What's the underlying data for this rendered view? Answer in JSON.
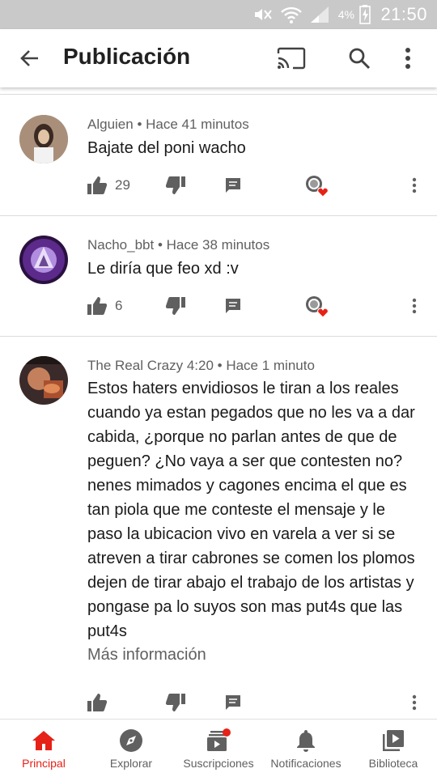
{
  "status_bar": {
    "battery": "4%",
    "time": "21:50"
  },
  "app_bar": {
    "title": "Publicación",
    "icons": [
      "back-arrow-icon",
      "cast-icon",
      "search-icon",
      "more-vert-icon"
    ]
  },
  "comments": [
    {
      "author": "Alguien",
      "time": "Hace 41 minutos",
      "text": "Bajate del poni wacho",
      "likes": "29"
    },
    {
      "author": "Nacho_bbt",
      "time": "Hace 38 minutos",
      "text": "Le diría que feo xd :v",
      "likes": "6"
    },
    {
      "author": "The Real Crazy 4:20",
      "time": "Hace 1 minuto",
      "text": "Estos haters envidiosos le tiran a los reales cuando ya estan pegados que no les va a dar cabida, ¿porque no parlan antes de que de peguen? ¿No vaya a ser que contesten no?nenes mimados y cagones encima el que es tan piola que me conteste el mensaje y le paso la ubicacion vivo en varela a ver si se atreven a tirar cabrones se comen los plomos dejen de tirar abajo el trabajo de los artistas y pongase pa lo suyos son mas put4s que las put4s",
      "more": "Más información",
      "likes": ""
    }
  ],
  "separator": " • ",
  "bottom_nav": [
    {
      "label": "Principal",
      "icon": "home-icon",
      "active": true
    },
    {
      "label": "Explorar",
      "icon": "compass-icon",
      "active": false
    },
    {
      "label": "Suscripciones",
      "icon": "subscriptions-icon",
      "active": false
    },
    {
      "label": "Notificaciones",
      "icon": "bell-icon",
      "active": false
    },
    {
      "label": "Biblioteca",
      "icon": "library-icon",
      "active": false
    }
  ],
  "colors": {
    "accent": "#e62117",
    "statusbar": "#c9c9c9",
    "text_secondary": "#606060"
  }
}
